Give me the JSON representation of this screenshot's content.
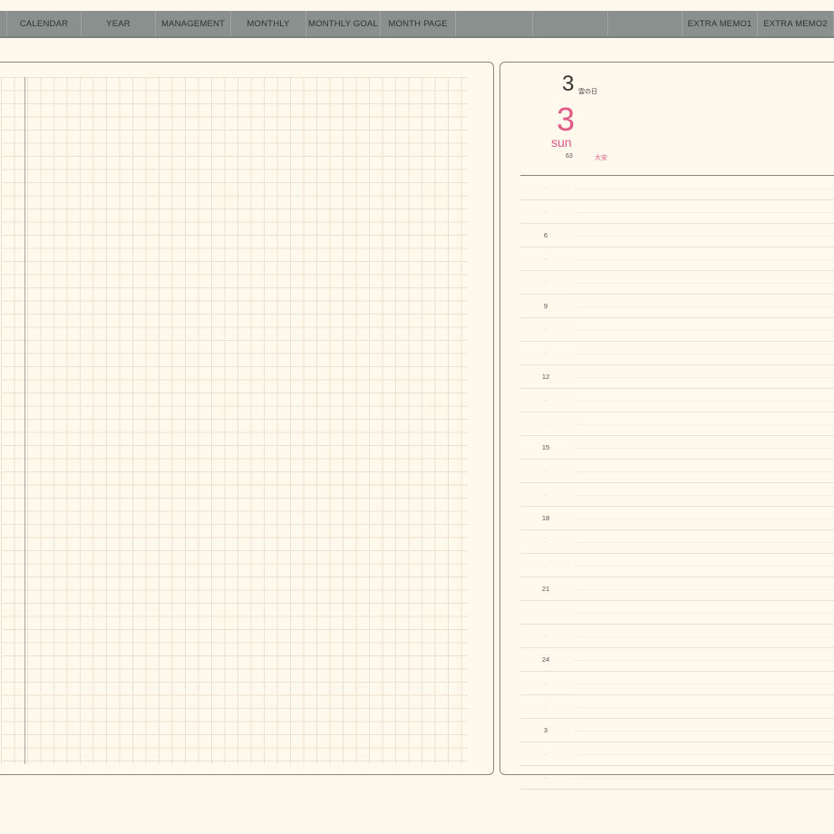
{
  "nav": {
    "tabs": [
      {
        "label": "",
        "width": 8
      },
      {
        "label": "CALENDAR",
        "width": 82
      },
      {
        "label": "YEAR",
        "width": 82
      },
      {
        "label": "MANAGEMENT",
        "width": 83
      },
      {
        "label": "MONTHLY",
        "width": 83
      },
      {
        "label": "MONTHLY GOAL",
        "width": 82
      },
      {
        "label": "MONTH PAGE",
        "width": 83
      },
      {
        "label": "",
        "width": 85
      },
      {
        "label": "",
        "width": 83
      },
      {
        "label": "",
        "width": 82
      },
      {
        "label": "EXTRA MEMO1",
        "width": 83
      },
      {
        "label": "EXTRA MEMO2",
        "width": 84
      }
    ]
  },
  "day": {
    "month": "3",
    "month_label": "雲の日",
    "day_number": "3",
    "weekday": "sun",
    "day_of_year": "63",
    "rokuyo": "大安"
  },
  "schedule": {
    "hours": [
      "",
      "",
      "6",
      "",
      "",
      "9",
      "",
      "",
      "12",
      "",
      "",
      "15",
      "",
      "",
      "18",
      "",
      "",
      "21",
      "",
      "",
      "24",
      "",
      "",
      "3",
      "",
      ""
    ]
  },
  "colors": {
    "nav_bg": "#8a908e",
    "accent_pink": "#e05a86",
    "paper": "#fff8ec"
  }
}
